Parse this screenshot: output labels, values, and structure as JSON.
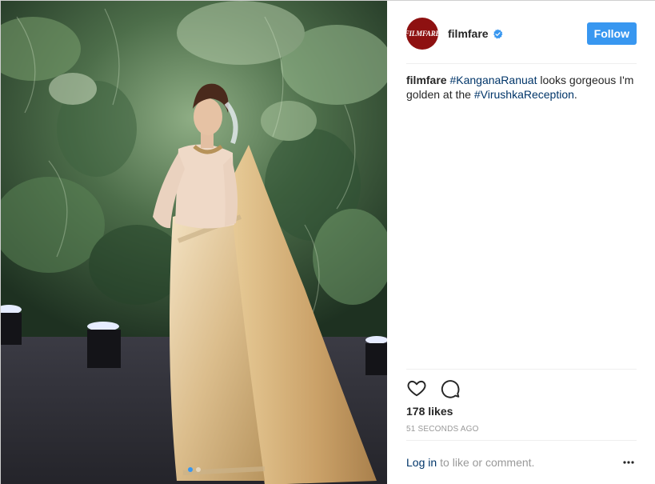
{
  "post": {
    "username": "filmfare",
    "avatar_text": "FILMFARE",
    "follow_label": "Follow",
    "caption": {
      "user": "filmfare",
      "tag1": "#KanganaRanuat",
      "text1": " looks gorgeous I'm golden at the ",
      "tag2": "#VirushkaReception",
      "text2": "."
    },
    "likes": "178 likes",
    "time": "51 seconds ago",
    "login_link": "Log in",
    "login_rest": "to like or comment.",
    "carousel": {
      "count": 2,
      "active": 0
    }
  },
  "colors": {
    "accent": "#3897f0",
    "hashtag": "#003569",
    "avatar_bg": "#8e1111",
    "muted": "#999999"
  },
  "icons": [
    "verified-badge-icon",
    "heart-icon",
    "comment-icon",
    "more-options-icon"
  ]
}
